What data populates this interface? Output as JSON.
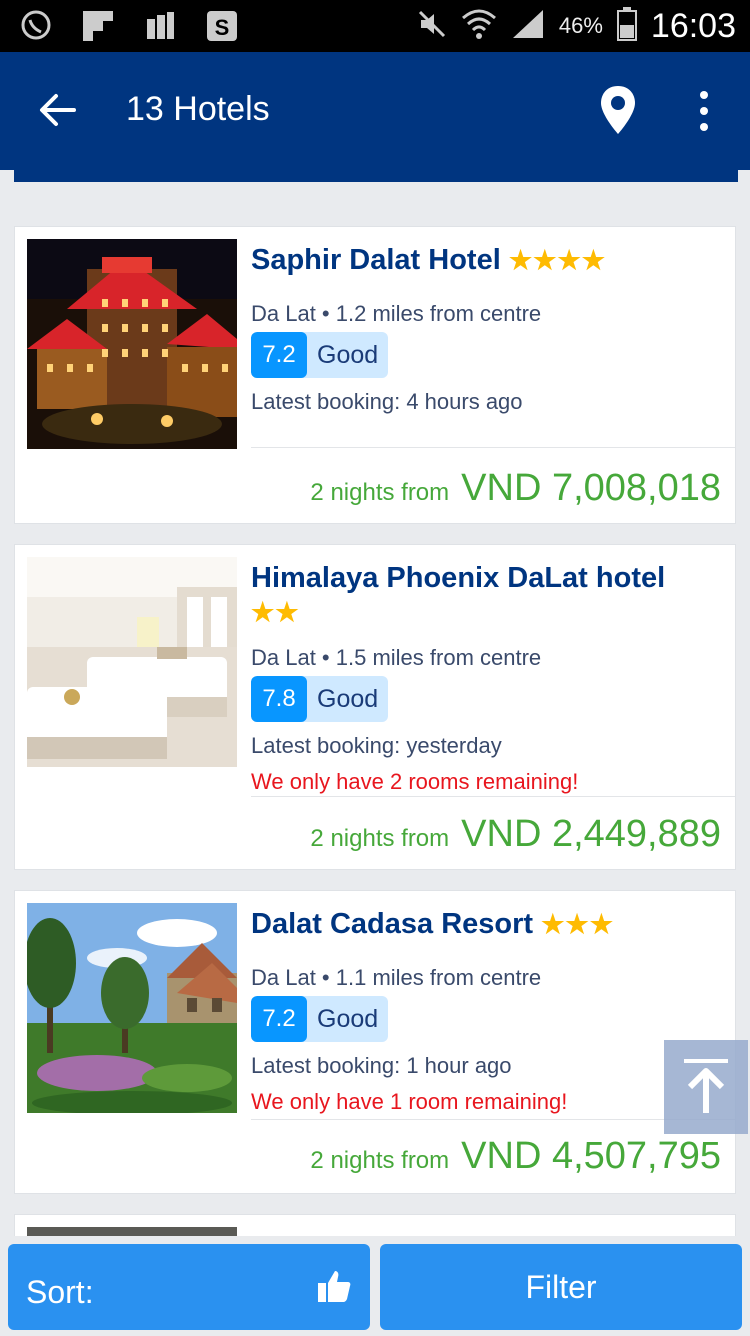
{
  "status_bar": {
    "battery": "46%",
    "time": "16:03"
  },
  "app_bar": {
    "title": "13 Hotels"
  },
  "hotels": [
    {
      "name": "Saphir Dalat Hotel",
      "stars": "★★★★",
      "distance": "Da Lat • 1.2 miles from centre",
      "score": "7.2",
      "score_label": "Good",
      "latest_booking": "Latest booking: 4 hours ago",
      "price_prefix": "2 nights from",
      "price": "VND 7,008,018"
    },
    {
      "name": "Himalaya Phoenix DaLat hotel",
      "stars": "★★",
      "distance": "Da Lat • 1.5 miles from centre",
      "score": "7.8",
      "score_label": "Good",
      "latest_booking": "Latest booking: yesterday",
      "remaining": "We only have 2 rooms remaining!",
      "price_prefix": "2 nights from",
      "price": "VND 2,449,889"
    },
    {
      "name": "Dalat Cadasa Resort",
      "stars": "★★★",
      "distance": "Da Lat • 1.1 miles from centre",
      "score": "7.2",
      "score_label": "Good",
      "latest_booking": "Latest booking: 1 hour ago",
      "remaining": "We only have 1 room remaining!",
      "price_prefix": "2 nights from",
      "price": "VND 4,507,795"
    }
  ],
  "bottom_bar": {
    "sort_label": "Sort:",
    "filter_label": "Filter"
  },
  "colors": {
    "brand": "#003580",
    "button": "#2a91f0",
    "price": "#46a83a",
    "alert": "#e8161e",
    "star": "#febb02"
  }
}
